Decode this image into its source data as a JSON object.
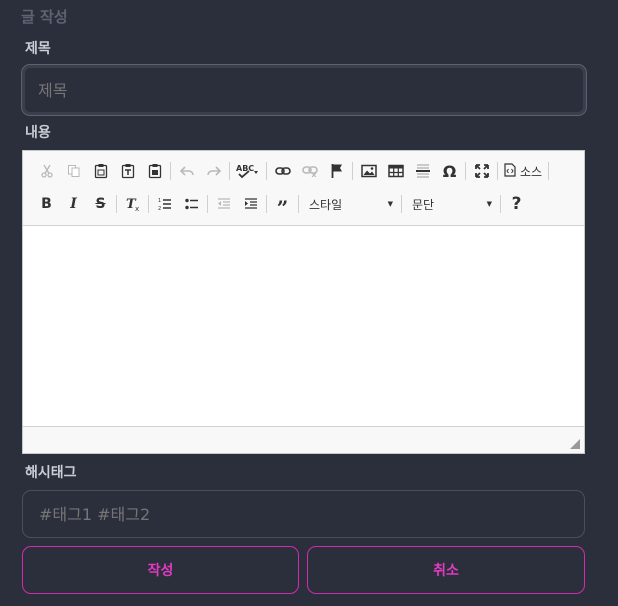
{
  "page": {
    "heading": "글 작성"
  },
  "form": {
    "title_label": "제목",
    "title_placeholder": "제목",
    "content_label": "내용",
    "tags_label": "해시태그",
    "tags_placeholder": "#태그1 #태그2"
  },
  "editor": {
    "source_label": "소스",
    "style_combo": "스타일",
    "format_combo": "문단",
    "toolbar_row1": [
      "cut-icon",
      "copy-icon",
      "paste-icon",
      "paste-text-icon",
      "paste-word-icon",
      "undo-icon",
      "redo-icon",
      "spellcheck-icon",
      "link-icon",
      "unlink-icon",
      "anchor-icon",
      "image-icon",
      "table-icon",
      "horizontal-rule-icon",
      "special-char-icon",
      "maximize-icon",
      "source-icon"
    ],
    "toolbar_row2": [
      "bold-icon",
      "italic-icon",
      "strike-icon",
      "remove-format-icon",
      "numbered-list-icon",
      "bulleted-list-icon",
      "outdent-icon",
      "indent-icon",
      "blockquote-icon",
      "help-icon"
    ]
  },
  "actions": {
    "submit_label": "작성",
    "cancel_label": "취소"
  },
  "colors": {
    "background": "#2b2f3b",
    "accent": "#e23ac2",
    "border": "#4a4f5c"
  }
}
